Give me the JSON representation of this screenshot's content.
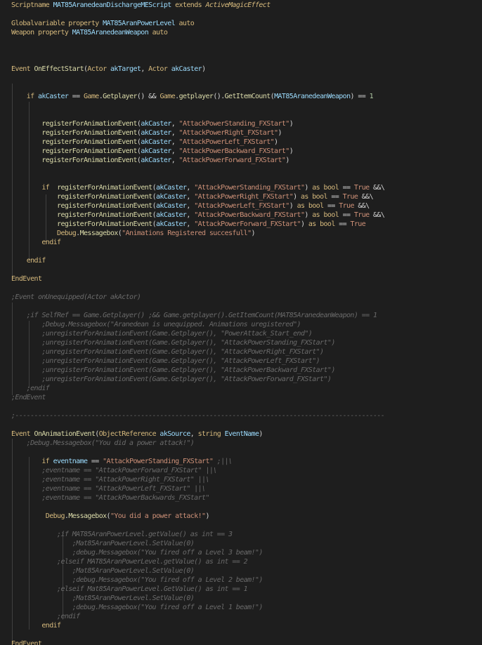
{
  "colors": {
    "background": "#1e1e1e",
    "default": "#d4d4d4",
    "keyword": "#d7ba7d",
    "func": "#dcdcaa",
    "variable": "#9cdcfe",
    "string": "#ce9178",
    "comment": "#6a6a6a",
    "bool": "#ce9178",
    "number": "#b5cea8",
    "type": "#4ec9b0",
    "indent_guide": "#404040"
  },
  "code_lines": [
    [
      [
        "keyword",
        "Scriptname "
      ],
      [
        "variable",
        "MAT85AranedeanDischargeMEScript "
      ],
      [
        "keyword",
        "extends "
      ],
      [
        "italic-type",
        "ActiveMagicEffect"
      ]
    ],
    [],
    [
      [
        "keyword",
        "Globalvariable property "
      ],
      [
        "variable",
        "MAT85AranPowerLevel "
      ],
      [
        "keyword",
        "auto"
      ]
    ],
    [
      [
        "keyword",
        "Weapon property "
      ],
      [
        "variable",
        "MAT85AranedeanWeapon "
      ],
      [
        "keyword",
        "auto"
      ]
    ],
    [],
    [],
    [],
    [
      [
        "keyword",
        "Event "
      ],
      [
        "func",
        "OnEffectStart"
      ],
      [
        "default",
        "("
      ],
      [
        "keyword",
        "Actor "
      ],
      [
        "variable",
        "akTarget"
      ],
      [
        "default",
        ", "
      ],
      [
        "keyword",
        "Actor "
      ],
      [
        "variable",
        "akCaster"
      ],
      [
        "default",
        ")"
      ]
    ],
    [],
    [],
    [
      [
        "default",
        "    "
      ],
      [
        "keyword",
        "if "
      ],
      [
        "variable",
        "akCaster "
      ],
      [
        "default",
        "== "
      ],
      [
        "keyword",
        "Game"
      ],
      [
        "default",
        "."
      ],
      [
        "func",
        "Getplayer"
      ],
      [
        "default",
        "() && "
      ],
      [
        "keyword",
        "Game"
      ],
      [
        "default",
        "."
      ],
      [
        "func",
        "getplayer"
      ],
      [
        "default",
        "()."
      ],
      [
        "func",
        "GetItemCount"
      ],
      [
        "default",
        "("
      ],
      [
        "variable",
        "MAT85AranedeanWeapon"
      ],
      [
        "default",
        ") == "
      ],
      [
        "number",
        "1"
      ]
    ],
    [],
    [],
    [
      [
        "default",
        "        "
      ],
      [
        "func",
        "registerForAnimationEvent"
      ],
      [
        "default",
        "("
      ],
      [
        "variable",
        "akCaster"
      ],
      [
        "default",
        ", "
      ],
      [
        "string",
        "\"AttackPowerStanding_FXStart\""
      ],
      [
        "default",
        ")"
      ]
    ],
    [
      [
        "default",
        "        "
      ],
      [
        "func",
        "registerForAnimationEvent"
      ],
      [
        "default",
        "("
      ],
      [
        "variable",
        "akCaster"
      ],
      [
        "default",
        ", "
      ],
      [
        "string",
        "\"AttackPowerRight_FXStart\""
      ],
      [
        "default",
        ")"
      ]
    ],
    [
      [
        "default",
        "        "
      ],
      [
        "func",
        "registerForAnimationEvent"
      ],
      [
        "default",
        "("
      ],
      [
        "variable",
        "akCaster"
      ],
      [
        "default",
        ", "
      ],
      [
        "string",
        "\"AttackPowerLeft_FXStart\""
      ],
      [
        "default",
        ")"
      ]
    ],
    [
      [
        "default",
        "        "
      ],
      [
        "func",
        "registerForAnimationEvent"
      ],
      [
        "default",
        "("
      ],
      [
        "variable",
        "akCaster"
      ],
      [
        "default",
        ", "
      ],
      [
        "string",
        "\"AttackPowerBackward_FXStart\""
      ],
      [
        "default",
        ")"
      ]
    ],
    [
      [
        "default",
        "        "
      ],
      [
        "func",
        "registerForAnimationEvent"
      ],
      [
        "default",
        "("
      ],
      [
        "variable",
        "akCaster"
      ],
      [
        "default",
        ", "
      ],
      [
        "string",
        "\"AttackPowerForward_FXStart\""
      ],
      [
        "default",
        ")"
      ]
    ],
    [],
    [],
    [
      [
        "default",
        "        "
      ],
      [
        "keyword",
        "if  "
      ],
      [
        "func",
        "registerForAnimationEvent"
      ],
      [
        "default",
        "("
      ],
      [
        "variable",
        "akCaster"
      ],
      [
        "default",
        ", "
      ],
      [
        "string",
        "\"AttackPowerStanding_FXStart\""
      ],
      [
        "default",
        ") "
      ],
      [
        "keyword",
        "as bool "
      ],
      [
        "default",
        "== "
      ],
      [
        "bool",
        "True "
      ],
      [
        "default",
        "&&\\"
      ]
    ],
    [
      [
        "default",
        "            "
      ],
      [
        "func",
        "registerForAnimationEvent"
      ],
      [
        "default",
        "("
      ],
      [
        "variable",
        "akCaster"
      ],
      [
        "default",
        ", "
      ],
      [
        "string",
        "\"AttackPowerRight_FXStart\""
      ],
      [
        "default",
        ") "
      ],
      [
        "keyword",
        "as bool "
      ],
      [
        "default",
        "== "
      ],
      [
        "bool",
        "True "
      ],
      [
        "default",
        "&&\\"
      ]
    ],
    [
      [
        "default",
        "            "
      ],
      [
        "func",
        "registerForAnimationEvent"
      ],
      [
        "default",
        "("
      ],
      [
        "variable",
        "akCaster"
      ],
      [
        "default",
        ", "
      ],
      [
        "string",
        "\"AttackPowerLeft_FXStart\""
      ],
      [
        "default",
        ") "
      ],
      [
        "keyword",
        "as bool "
      ],
      [
        "default",
        "== "
      ],
      [
        "bool",
        "True "
      ],
      [
        "default",
        "&&\\"
      ]
    ],
    [
      [
        "default",
        "            "
      ],
      [
        "func",
        "registerForAnimationEvent"
      ],
      [
        "default",
        "("
      ],
      [
        "variable",
        "akCaster"
      ],
      [
        "default",
        ", "
      ],
      [
        "string",
        "\"AttackPowerBackward_FXStart\""
      ],
      [
        "default",
        ") "
      ],
      [
        "keyword",
        "as bool "
      ],
      [
        "default",
        "== "
      ],
      [
        "bool",
        "True "
      ],
      [
        "default",
        "&&\\"
      ]
    ],
    [
      [
        "default",
        "            "
      ],
      [
        "func",
        "registerForAnimationEvent"
      ],
      [
        "default",
        "("
      ],
      [
        "variable",
        "akCaster"
      ],
      [
        "default",
        ", "
      ],
      [
        "string",
        "\"AttackPowerForward_FXStart\""
      ],
      [
        "default",
        ") "
      ],
      [
        "keyword",
        "as bool "
      ],
      [
        "default",
        "== "
      ],
      [
        "bool",
        "True"
      ]
    ],
    [
      [
        "default",
        "            "
      ],
      [
        "keyword",
        "Debug"
      ],
      [
        "default",
        "."
      ],
      [
        "func",
        "Messagebox"
      ],
      [
        "default",
        "("
      ],
      [
        "string",
        "\"Animations Registered succesfull\""
      ],
      [
        "default",
        ")"
      ]
    ],
    [
      [
        "default",
        "        "
      ],
      [
        "keyword",
        "endif"
      ]
    ],
    [],
    [
      [
        "default",
        "    "
      ],
      [
        "keyword",
        "endif"
      ]
    ],
    [],
    [
      [
        "keyword",
        "EndEvent"
      ]
    ],
    [],
    [
      [
        "comment",
        ";Event onUnequipped(Actor akActor)"
      ]
    ],
    [],
    [
      [
        "comment",
        "    ;if SelfRef == Game.Getplayer() ;&& Game.getplayer().GetItemCount(MAT85AranedeanWeapon) == 1"
      ]
    ],
    [
      [
        "comment",
        "        ;Debug.Messagebox(\"Aranedean is unequipped. Animations uregistered\")"
      ]
    ],
    [
      [
        "comment",
        "        ;unregisterForAnimationEvent(Game.Getplayer(), \"PowerAttack_Start_end\")"
      ]
    ],
    [
      [
        "comment",
        "        ;unregisterForAnimationEvent(Game.Getplayer(), \"AttackPowerStanding_FXStart\")"
      ]
    ],
    [
      [
        "comment",
        "        ;unregisterForAnimationEvent(Game.Getplayer(), \"AttackPowerRight_FXStart\")"
      ]
    ],
    [
      [
        "comment",
        "        ;unregisterForAnimationEvent(Game.Getplayer(), \"AttackPowerLeft_FXStart\")"
      ]
    ],
    [
      [
        "comment",
        "        ;unregisterForAnimationEvent(Game.Getplayer(), \"AttackPowerBackward_FXStart\")"
      ]
    ],
    [
      [
        "comment",
        "        ;unregisterForAnimationEvent(Game.Getplayer(), \"AttackPowerForward_FXStart\")"
      ]
    ],
    [
      [
        "comment",
        "    ;endif"
      ]
    ],
    [
      [
        "comment",
        ";EndEvent"
      ]
    ],
    [],
    [
      [
        "comment",
        ";-------------------------------------------------------------------------------------------------"
      ]
    ],
    [],
    [
      [
        "keyword",
        "Event "
      ],
      [
        "func",
        "OnAnimationEvent"
      ],
      [
        "default",
        "("
      ],
      [
        "keyword",
        "ObjectReference "
      ],
      [
        "variable",
        "akSource"
      ],
      [
        "default",
        ", "
      ],
      [
        "keyword",
        "string "
      ],
      [
        "variable",
        "EventName"
      ],
      [
        "default",
        ")"
      ]
    ],
    [
      [
        "comment",
        "    ;Debug.Messagebox(\"You did a power attack!\")"
      ]
    ],
    [],
    [
      [
        "default",
        "        "
      ],
      [
        "keyword",
        "if "
      ],
      [
        "variable",
        "eventname "
      ],
      [
        "default",
        "== "
      ],
      [
        "string",
        "\"AttackPowerStanding_FXStart\" "
      ],
      [
        "comment",
        ";||\\"
      ]
    ],
    [
      [
        "comment",
        "        ;eventname == \"AttackPowerForward_FXStart\" ||\\"
      ]
    ],
    [
      [
        "comment",
        "        ;eventname == \"AttackPowerRight_FXStart\" ||\\"
      ]
    ],
    [
      [
        "comment",
        "        ;eventname == \"AttackPowerLeft_FXStart\" ||\\"
      ]
    ],
    [
      [
        "comment",
        "        ;eventname == \"AttackPowerBackwards_FXStart\""
      ]
    ],
    [],
    [
      [
        "default",
        "         "
      ],
      [
        "keyword",
        "Debug"
      ],
      [
        "default",
        "."
      ],
      [
        "func",
        "Messagebox"
      ],
      [
        "default",
        "("
      ],
      [
        "string",
        "\"You did a power attack!\""
      ],
      [
        "default",
        ")"
      ]
    ],
    [],
    [
      [
        "comment",
        "            ;if MAT85AranPowerLevel.getValue() as int == 3"
      ]
    ],
    [
      [
        "comment",
        "                ;Mat85AranPowerLevel.SetValue(0)"
      ]
    ],
    [
      [
        "comment",
        "                ;debug.Messagebox(\"You fired off a Level 3 beam!\")"
      ]
    ],
    [
      [
        "comment",
        "            ;elseif MAT85AranPowerLevel.getValue() as int == 2"
      ]
    ],
    [
      [
        "comment",
        "                ;Mat85AranPowerLevel.SetValue(0)"
      ]
    ],
    [
      [
        "comment",
        "                ;debug.Messagebox(\"You fired off a Level 2 beam!\")"
      ]
    ],
    [
      [
        "comment",
        "            ;elseif Mat85AranPowerLevel.GetValue() as int == 1"
      ]
    ],
    [
      [
        "comment",
        "                ;Mat85AranPowerLevel.SetValue(0)"
      ]
    ],
    [
      [
        "comment",
        "                ;debug.Messagebox(\"You fired off a Level 1 beam!\")"
      ]
    ],
    [
      [
        "comment",
        "            ;endif"
      ]
    ],
    [
      [
        "default",
        "        "
      ],
      [
        "keyword",
        "endif"
      ]
    ],
    [],
    [
      [
        "keyword",
        "EndEvent"
      ]
    ]
  ]
}
